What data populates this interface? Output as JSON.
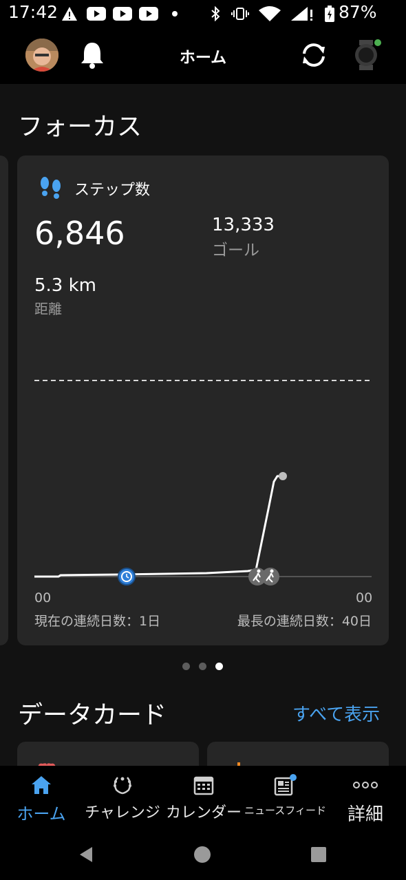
{
  "status_bar": {
    "time": "17:42",
    "battery": "87%"
  },
  "header": {
    "title": "ホーム"
  },
  "focus": {
    "heading": "フォーカス",
    "steps_card": {
      "title": "ステップ数",
      "steps": "6,846",
      "goal_value": "13,333",
      "goal_label": "ゴール",
      "distance_value": "5.3 km",
      "distance_label": "距離",
      "x_label_start": "00",
      "x_label_end": "00",
      "current_streak": "現在の連続日数：1日",
      "longest_streak": "最長の連続日数：40日"
    },
    "pager": {
      "count": 3,
      "active_index": 2
    }
  },
  "data_cards": {
    "heading": "データカード",
    "show_all": "すべて表示"
  },
  "bottom_nav": {
    "items": [
      {
        "label": "ホーム",
        "icon": "home-icon",
        "active": true
      },
      {
        "label": "チャレンジ",
        "icon": "laurel-icon",
        "active": false
      },
      {
        "label": "カレンダー",
        "icon": "calendar-icon",
        "active": false
      },
      {
        "label": "ニュースフィード",
        "icon": "newsfeed-icon",
        "active": false
      },
      {
        "label": "詳細",
        "icon": "more-icon",
        "active": false
      }
    ]
  },
  "colors": {
    "accent": "#4aa3f0",
    "card": "#262626",
    "background": "#121212",
    "notification_dot": "#4caf50"
  }
}
